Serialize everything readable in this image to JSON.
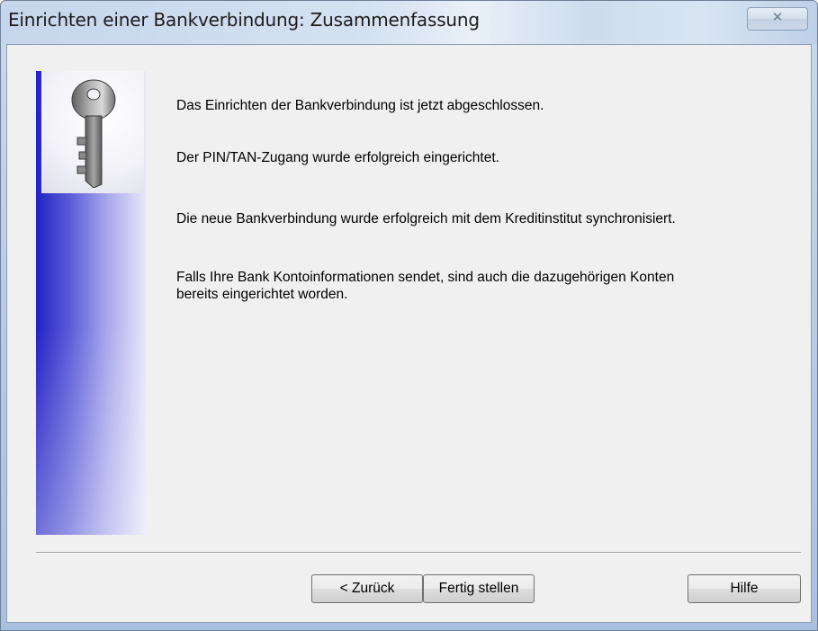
{
  "window": {
    "title": "Einrichten einer Bankverbindung: Zusammenfassung",
    "close_glyph": "✕"
  },
  "icons": {
    "close": "close-icon",
    "key": "key-icon"
  },
  "content": {
    "line1": "Das Einrichten der Bankverbindung ist jetzt abgeschlossen.",
    "line2": "Der PIN/TAN-Zugang wurde erfolgreich eingerichtet.",
    "line3": "Die neue Bankverbindung wurde erfolgreich mit dem Kreditinstitut synchronisiert.",
    "line4a": "Falls Ihre Bank Kontoinformationen sendet, sind auch die dazugehörigen Konten",
    "line4b": "bereits eingerichtet worden."
  },
  "buttons": {
    "back": "< Zurück",
    "finish": "Fertig stellen",
    "help": "Hilfe"
  },
  "colors": {
    "side_panel_dark": "#2121c4",
    "dialog_bg": "#f0f0f0"
  }
}
